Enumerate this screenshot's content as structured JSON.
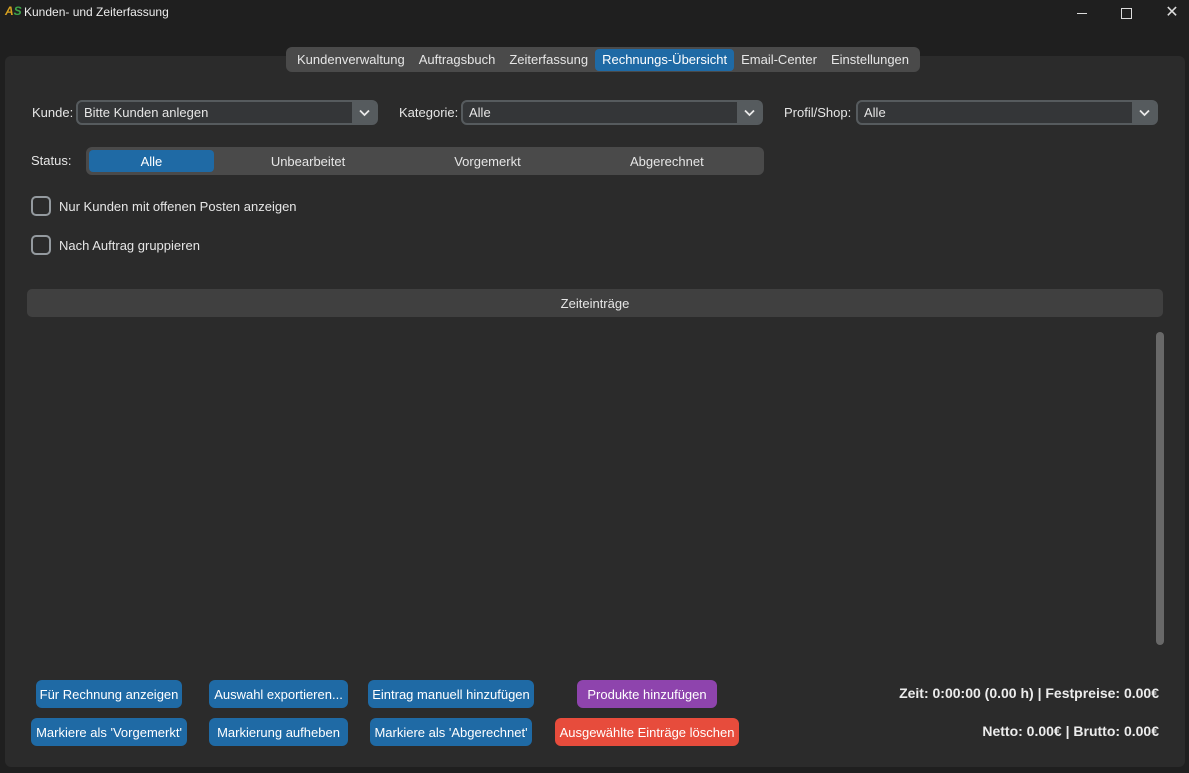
{
  "window": {
    "icon_text": "AS",
    "title": "Kunden- und Zeiterfassung",
    "minimize_icon": "minimize-icon",
    "maximize_icon": "maximize-icon",
    "close_icon": "close-icon"
  },
  "tabs": [
    {
      "label": "Kundenverwaltung",
      "active": false
    },
    {
      "label": "Auftragsbuch",
      "active": false
    },
    {
      "label": "Zeiterfassung",
      "active": false
    },
    {
      "label": "Rechnungs-Übersicht",
      "active": true
    },
    {
      "label": "Email-Center",
      "active": false
    },
    {
      "label": "Einstellungen",
      "active": false
    }
  ],
  "filters": {
    "kunde_label": "Kunde:",
    "kunde_value": "Bitte Kunden anlegen",
    "kategorie_label": "Kategorie:",
    "kategorie_value": "Alle",
    "profil_label": "Profil/Shop:",
    "profil_value": "Alle"
  },
  "status": {
    "label": "Status:",
    "options": [
      {
        "label": "Alle",
        "active": true
      },
      {
        "label": "Unbearbeitet",
        "active": false
      },
      {
        "label": "Vorgemerkt",
        "active": false
      },
      {
        "label": "Abgerechnet",
        "active": false
      }
    ]
  },
  "checkboxes": {
    "offene_posten": {
      "label": "Nur Kunden mit offenen Posten anzeigen",
      "checked": false
    },
    "gruppieren": {
      "label": "Nach Auftrag gruppieren",
      "checked": false
    }
  },
  "entries": {
    "header": "Zeiteinträge",
    "rows": []
  },
  "buttons": {
    "rechnung_anzeigen": "Für Rechnung anzeigen",
    "exportieren": "Auswahl exportieren...",
    "manuell_hinzufuegen": "Eintrag manuell hinzufügen",
    "produkte_hinzufuegen": "Produkte hinzufügen",
    "markiere_vorgemerkt": "Markiere als 'Vorgemerkt'",
    "markierung_aufheben": "Markierung aufheben",
    "markiere_abgerechnet": "Markiere als 'Abgerechnet'",
    "eintraege_loeschen": "Ausgewählte Einträge löschen"
  },
  "summary": {
    "zeit": "Zeit: 0:00:00 (0.00 h) | Festpreise: 0.00€",
    "netto_brutto": "Netto: 0.00€ | Brutto: 0.00€"
  },
  "colors": {
    "accent": "#1f6aa5",
    "purple_button": "#8e44ad",
    "danger_button": "#e74c3c",
    "background": "#2b2b2b"
  }
}
